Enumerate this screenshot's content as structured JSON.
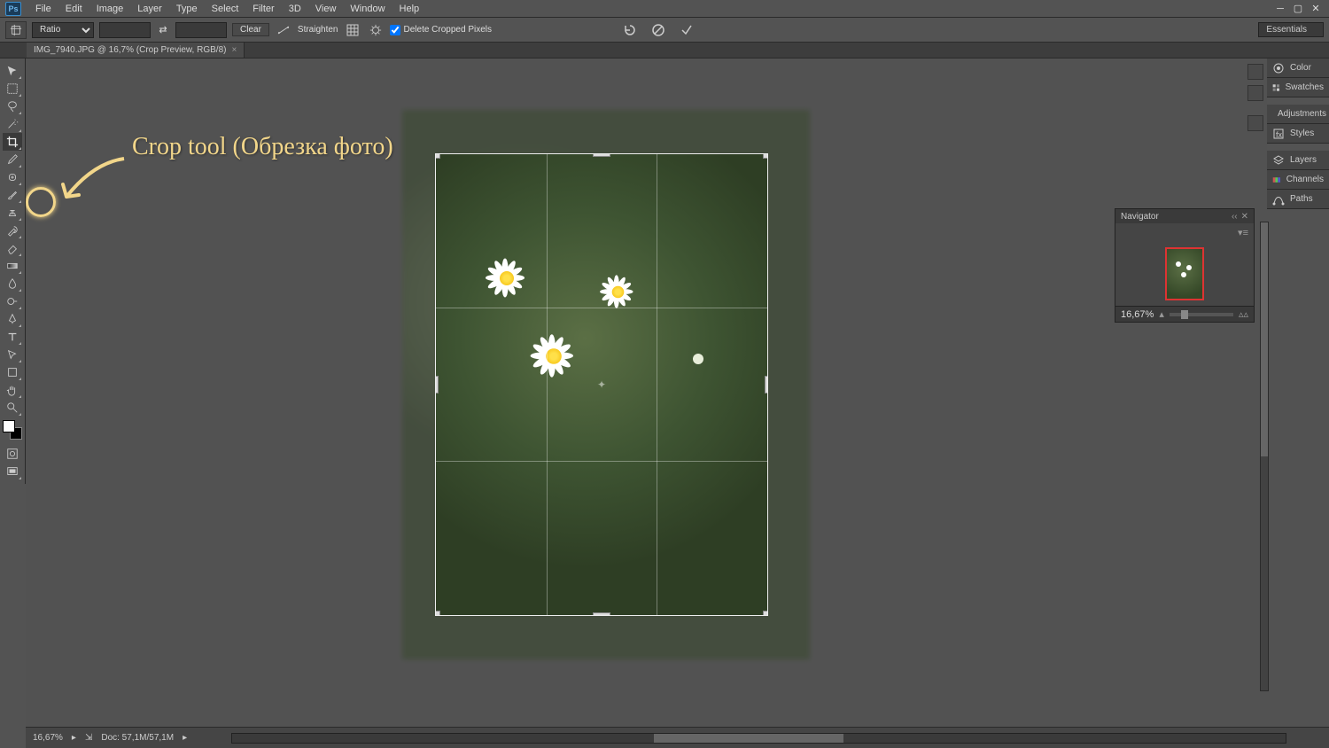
{
  "app": {
    "logo": "Ps"
  },
  "menu": [
    "File",
    "Edit",
    "Image",
    "Layer",
    "Type",
    "Select",
    "Filter",
    "3D",
    "View",
    "Window",
    "Help"
  ],
  "options": {
    "ratio_mode": "Ratio",
    "width": "",
    "height": "",
    "clear": "Clear",
    "straighten": "Straighten",
    "delete_cropped": "Delete Cropped Pixels",
    "workspace": "Essentials"
  },
  "doctab": {
    "title": "IMG_7940.JPG @ 16,7% (Crop Preview, RGB/8)",
    "close": "×"
  },
  "panels": {
    "color": "Color",
    "swatches": "Swatches",
    "adjustments": "Adjustments",
    "styles": "Styles",
    "layers": "Layers",
    "channels": "Channels",
    "paths": "Paths"
  },
  "navigator": {
    "title": "Navigator",
    "zoom": "16,67%"
  },
  "statusbar": {
    "zoom": "16,67%",
    "doc": "Doc: 57,1M/57,1M"
  },
  "annotation": {
    "text": "Crop tool (Обрезка фото)"
  }
}
